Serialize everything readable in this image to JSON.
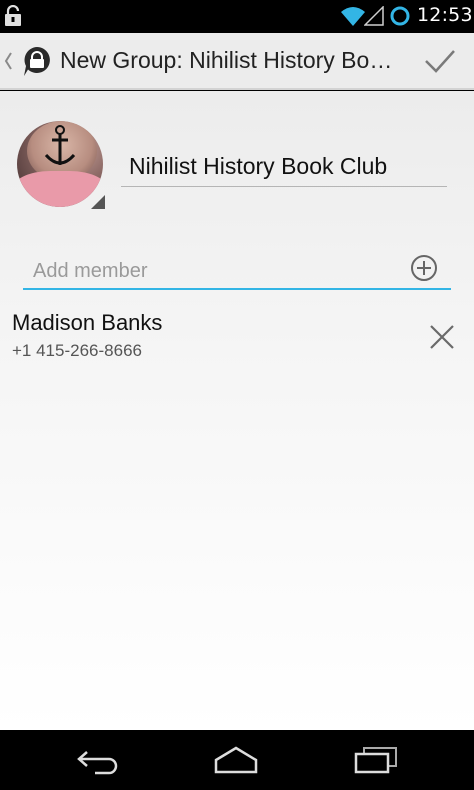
{
  "status_bar": {
    "time": "12:53",
    "icons": [
      "lock-icon",
      "wifi-icon",
      "signal-icon",
      "sync-icon"
    ]
  },
  "action_bar": {
    "title": "New Group: Nihilist History Boo…",
    "icons": [
      "up-caret-icon",
      "app-logo-icon",
      "checkmark-icon"
    ]
  },
  "group": {
    "name": "Nihilist History Book Club"
  },
  "add_member": {
    "placeholder": "Add member",
    "icon": "add-circle-icon"
  },
  "members": [
    {
      "name": "Madison Banks",
      "phone": "+1 415-266-8666"
    }
  ],
  "navigation": {
    "buttons": [
      "back-icon",
      "home-icon",
      "recents-icon"
    ]
  },
  "colors": {
    "accent": "#33b5e5",
    "action_bar_bg": "#ececec",
    "status_bar_bg": "#000000"
  }
}
